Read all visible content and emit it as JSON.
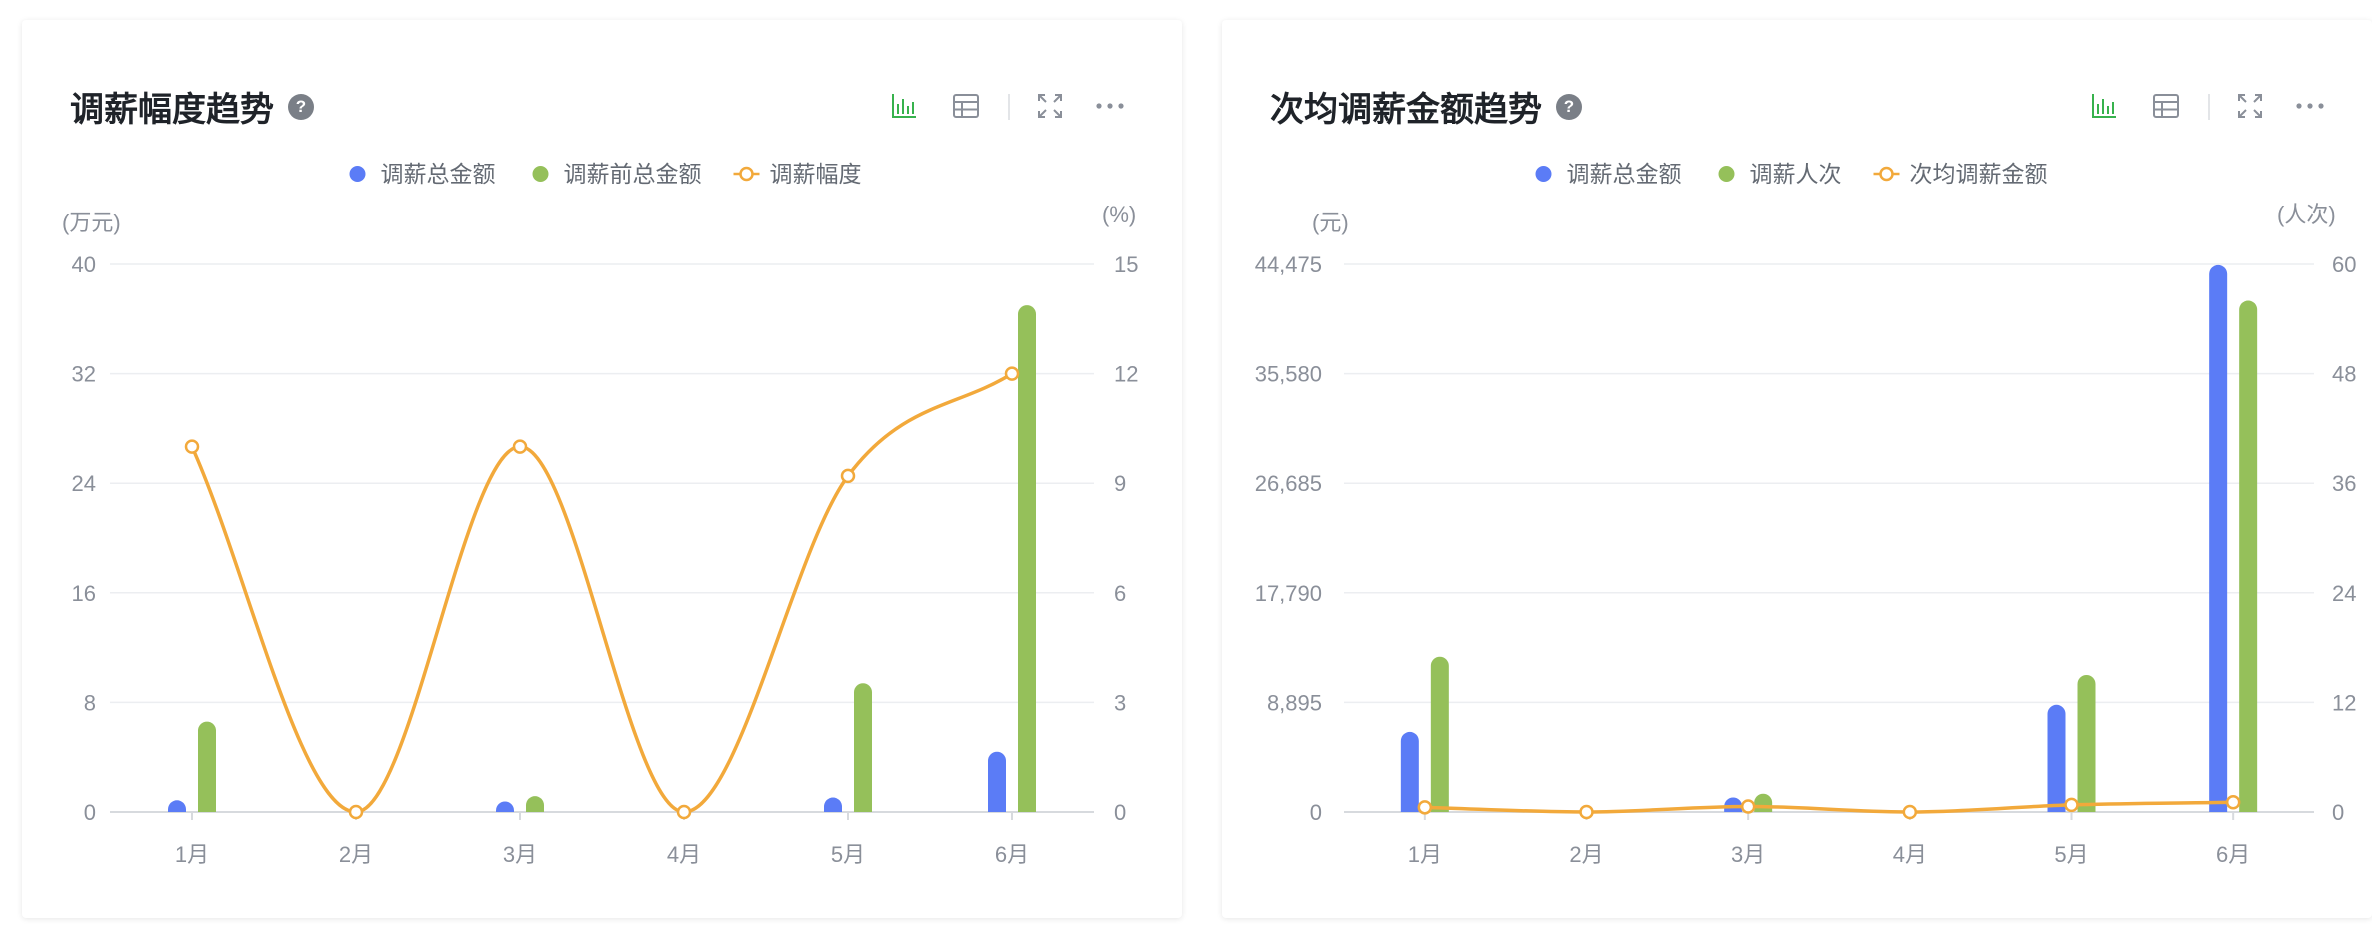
{
  "colors": {
    "blue": "#5b7cf6",
    "green": "#95c05a",
    "orange": "#f2a93b",
    "grid": "#eceef1",
    "axis_text": "#8a8f99",
    "active_icon": "#37b24d",
    "icon": "#8a8f99"
  },
  "icons": [
    "bar-chart-icon",
    "table-icon",
    "fullscreen-icon",
    "more-icon",
    "help-icon"
  ],
  "chart1": {
    "help": "?"
  },
  "chart2": {
    "help": "?"
  },
  "chart_data": [
    {
      "type": "bar",
      "title": "调薪幅度趋势",
      "categories": [
        "1月",
        "2月",
        "3月",
        "4月",
        "5月",
        "6月"
      ],
      "series": [
        {
          "name": "调薪总金额",
          "type": "bar",
          "axis": "left",
          "color": "#5b7cf6",
          "values": [
            0.4,
            0,
            0.1,
            0,
            0.8,
            4.4
          ]
        },
        {
          "name": "调薪前总金额",
          "type": "bar",
          "axis": "left",
          "color": "#95c05a",
          "values": [
            6.6,
            0,
            1.0,
            0,
            9.4,
            37.0
          ]
        },
        {
          "name": "调薪幅度",
          "type": "line",
          "axis": "right",
          "color": "#f2a93b",
          "values": [
            10.0,
            0,
            10.0,
            0,
            9.2,
            12.0
          ]
        }
      ],
      "y_left": {
        "unit": "(万元)",
        "ticks": [
          "0",
          "8",
          "16",
          "24",
          "32",
          "40"
        ],
        "min": 0,
        "max": 40
      },
      "y_right": {
        "unit": "(%)",
        "ticks": [
          "0",
          "3",
          "6",
          "9",
          "12",
          "15"
        ],
        "min": 0,
        "max": 15
      },
      "grid": true,
      "legend": "top-center"
    },
    {
      "type": "bar",
      "title": "次均调薪金额趋势",
      "categories": [
        "1月",
        "2月",
        "3月",
        "4月",
        "5月",
        "6月"
      ],
      "series": [
        {
          "name": "调薪总金额",
          "type": "bar",
          "axis": "left",
          "color": "#5b7cf6",
          "values": [
            6500,
            0,
            900,
            0,
            8700,
            44400
          ]
        },
        {
          "name": "调薪人次",
          "type": "bar",
          "axis": "right",
          "color": "#95c05a",
          "values": [
            17,
            0,
            2,
            0,
            15,
            56
          ]
        },
        {
          "name": "次均调薪金额",
          "type": "line",
          "axis": "left",
          "color": "#f2a93b",
          "values": [
            380,
            0,
            450,
            0,
            580,
            790
          ]
        }
      ],
      "y_left": {
        "unit": "(元)",
        "ticks": [
          "0",
          "8,895",
          "17,790",
          "26,685",
          "35,580",
          "44,475"
        ],
        "min": 0,
        "max": 44475
      },
      "y_right": {
        "unit": "(人次)",
        "ticks": [
          "0",
          "12",
          "24",
          "36",
          "48",
          "60"
        ],
        "min": 0,
        "max": 60
      },
      "grid": true,
      "legend": "top-center"
    }
  ]
}
